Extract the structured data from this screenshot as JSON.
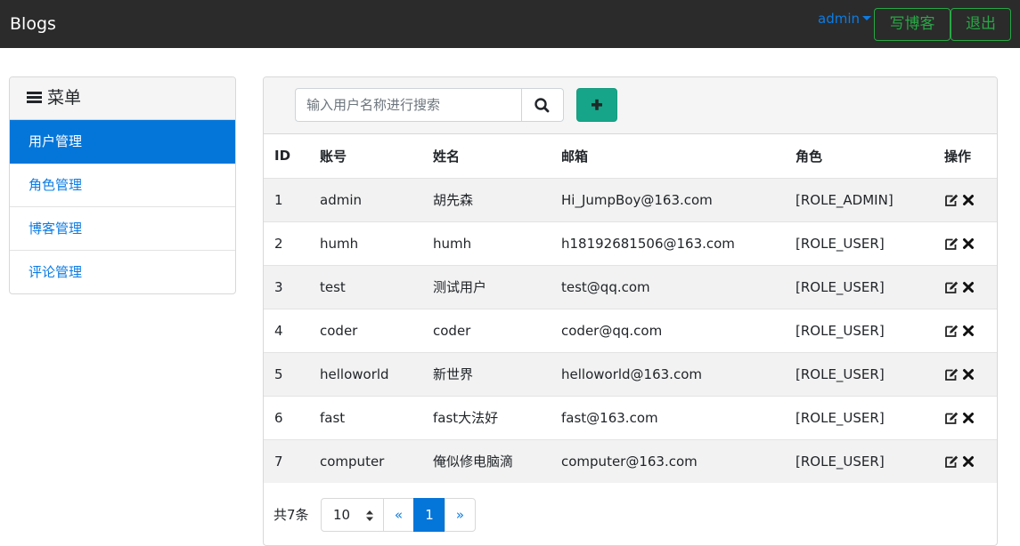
{
  "navbar": {
    "brand": "Blogs",
    "user": "admin",
    "write_label": "写博客",
    "logout_label": "退出"
  },
  "sidebar": {
    "title": "菜单",
    "items": [
      {
        "label": "用户管理",
        "active": true
      },
      {
        "label": "角色管理",
        "active": false
      },
      {
        "label": "博客管理",
        "active": false
      },
      {
        "label": "评论管理",
        "active": false
      }
    ]
  },
  "search": {
    "placeholder": "输入用户名称进行搜索",
    "value": ""
  },
  "table": {
    "headers": {
      "id": "ID",
      "account": "账号",
      "name": "姓名",
      "email": "邮箱",
      "role": "角色",
      "ops": "操作"
    },
    "rows": [
      {
        "id": "1",
        "account": "admin",
        "name": "胡先森",
        "email": "Hi_JumpBoy@163.com",
        "role": "[ROLE_ADMIN]"
      },
      {
        "id": "2",
        "account": "humh",
        "name": "humh",
        "email": "h18192681506@163.com",
        "role": "[ROLE_USER]"
      },
      {
        "id": "3",
        "account": "test",
        "name": "测试用户",
        "email": "test@qq.com",
        "role": "[ROLE_USER]"
      },
      {
        "id": "4",
        "account": "coder",
        "name": "coder",
        "email": "coder@qq.com",
        "role": "[ROLE_USER]"
      },
      {
        "id": "5",
        "account": "helloworld",
        "name": "新世界",
        "email": "helloworld@163.com",
        "role": "[ROLE_USER]"
      },
      {
        "id": "6",
        "account": "fast",
        "name": "fast大法好",
        "email": "fast@163.com",
        "role": "[ROLE_USER]"
      },
      {
        "id": "7",
        "account": "computer",
        "name": "俺似修电脑滴",
        "email": "computer@163.com",
        "role": "[ROLE_USER]"
      }
    ]
  },
  "pagination": {
    "total_text": "共7条",
    "page_size": "10",
    "prev": "«",
    "current": "1",
    "next": "»"
  },
  "colors": {
    "navbar_bg": "#2b2b2b",
    "link_blue": "#0d7ce3",
    "active_blue": "#0576d9",
    "outline_green": "#28a745",
    "add_teal": "#17a589"
  },
  "icons": {
    "menu": "hamburger-icon",
    "search": "search-icon",
    "add": "plus-icon",
    "edit": "edit-icon",
    "delete": "close-icon"
  }
}
